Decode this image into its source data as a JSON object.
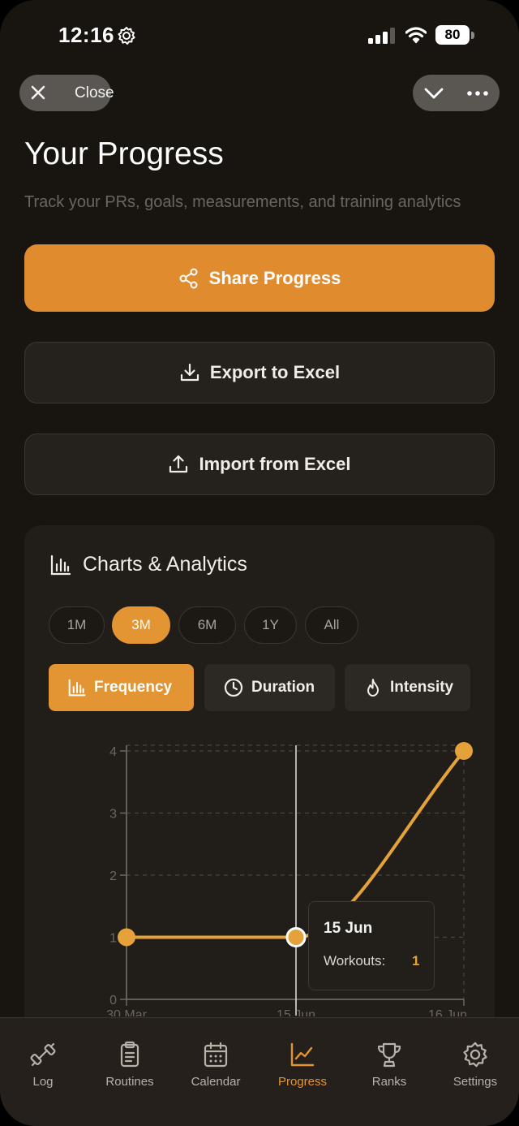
{
  "status_bar": {
    "time": "12:16",
    "battery": "80"
  },
  "nav": {
    "close_label": "Close"
  },
  "header": {
    "title": "Your Progress",
    "subtitle": "Track your PRs, goals, measurements, and training analytics"
  },
  "actions": {
    "share": "Share Progress",
    "export": "Export to Excel",
    "import": "Import from Excel"
  },
  "analytics": {
    "title": "Charts & Analytics",
    "ranges": [
      "1M",
      "3M",
      "6M",
      "1Y",
      "All"
    ],
    "selected_range": "3M",
    "metrics": [
      "Frequency",
      "Duration",
      "Intensity"
    ],
    "selected_metric": "Frequency"
  },
  "chart_data": {
    "type": "line",
    "x": [
      "30 Mar",
      "15 Jun",
      "16 Jun"
    ],
    "series": [
      {
        "values": [
          1,
          1,
          4
        ]
      }
    ],
    "y_ticks": [
      "0",
      "1",
      "2",
      "3",
      "4"
    ],
    "ylim": [
      0,
      4
    ],
    "grid": true,
    "color": "#e5a23a",
    "selected_point": {
      "x": "15 Jun",
      "label": "Workouts:",
      "value": "1"
    }
  },
  "tabbar": {
    "items": [
      {
        "label": "Log",
        "icon": "dumbbell-icon"
      },
      {
        "label": "Routines",
        "icon": "clipboard-icon"
      },
      {
        "label": "Calendar",
        "icon": "calendar-icon"
      },
      {
        "label": "Progress",
        "icon": "chart-line-icon"
      },
      {
        "label": "Ranks",
        "icon": "trophy-icon"
      },
      {
        "label": "Settings",
        "icon": "gear-icon"
      }
    ],
    "active": "Progress"
  },
  "colors": {
    "accent": "#e39533",
    "background": "#181410",
    "card": "#211d19"
  }
}
